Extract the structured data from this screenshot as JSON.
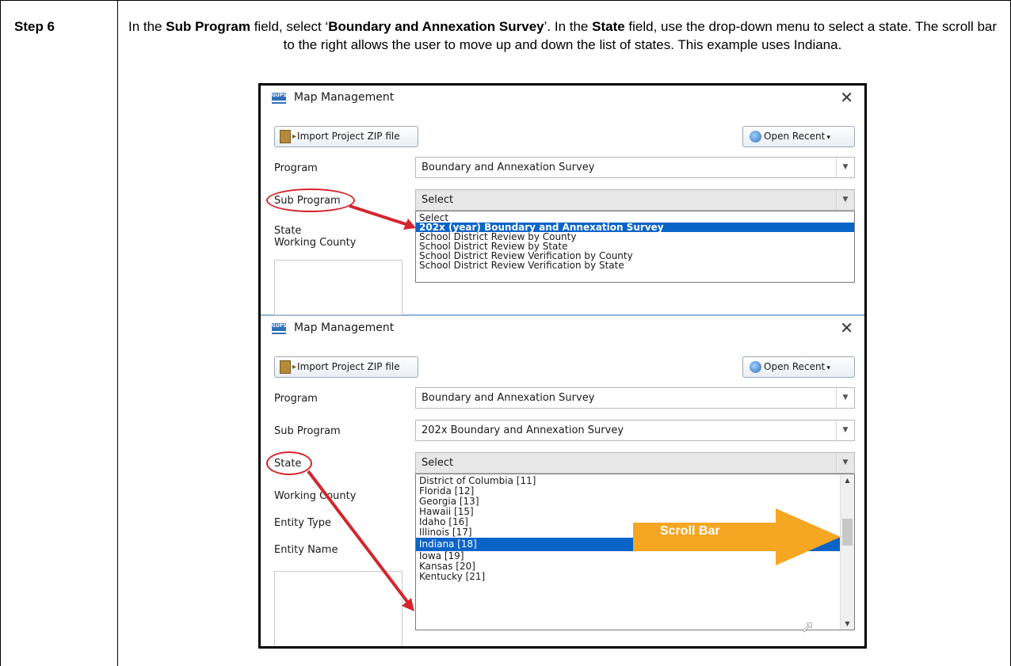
{
  "step": {
    "label": "Step 6"
  },
  "instructions": {
    "parts": [
      {
        "text": "In the ",
        "bold": false
      },
      {
        "text": "Sub Program",
        "bold": true
      },
      {
        "text": " field, select ‘",
        "bold": false
      },
      {
        "text": "Boundary and Annexation Survey",
        "bold": true
      },
      {
        "text": "’. In the ",
        "bold": false
      },
      {
        "text": "State",
        "bold": true
      },
      {
        "text": " field, use the drop-down menu to select a state. The scroll bar to the right allows the user to move up and down the list of states. This example uses Indiana.",
        "bold": false
      }
    ]
  },
  "window1": {
    "title": "Map Management",
    "app_icon_text": "GUPS",
    "close_icon": "close-icon",
    "import_button": "Import Project ZIP file",
    "open_recent_button": "Open Recent",
    "labels": {
      "program": "Program",
      "sub_program": "Sub Program",
      "state": "State",
      "working_county": "Working County"
    },
    "program_value": "Boundary and Annexation Survey",
    "sub_program_value": "Select",
    "sub_program_options": [
      "Select",
      "202x (year) Boundary and Annexation Survey",
      "School District Review by County",
      "School District Review by State",
      "School District Review Verification by County",
      "School District Review Verification by State"
    ],
    "selected_option_index": 1
  },
  "window2": {
    "title": "Map Management",
    "app_icon_text": "GUPS",
    "close_icon": "close-icon",
    "import_button": "Import Project ZIP file",
    "open_recent_button": "Open Recent",
    "labels": {
      "program": "Program",
      "sub_program": "Sub Program",
      "state": "State",
      "working_county": "Working County",
      "entity_type": "Entity Type",
      "entity_name": "Entity Name"
    },
    "program_value": "Boundary and Annexation Survey",
    "sub_program_value": "202x Boundary and Annexation Survey",
    "state_value": "Select",
    "state_options": [
      "District of Columbia [11]",
      "Florida [12]",
      "Georgia [13]",
      "Hawaii [15]",
      "Idaho [16]",
      "Illinois [17]",
      "Indiana [18]",
      "Iowa [19]",
      "Kansas [20]",
      "Kentucky [21]"
    ],
    "selected_option_index": 6,
    "scroll_annotation": "Scroll Bar"
  },
  "colors": {
    "highlight": "#0a64c8",
    "callout_red": "#d3262e",
    "arrow_orange": "#f5a623"
  }
}
